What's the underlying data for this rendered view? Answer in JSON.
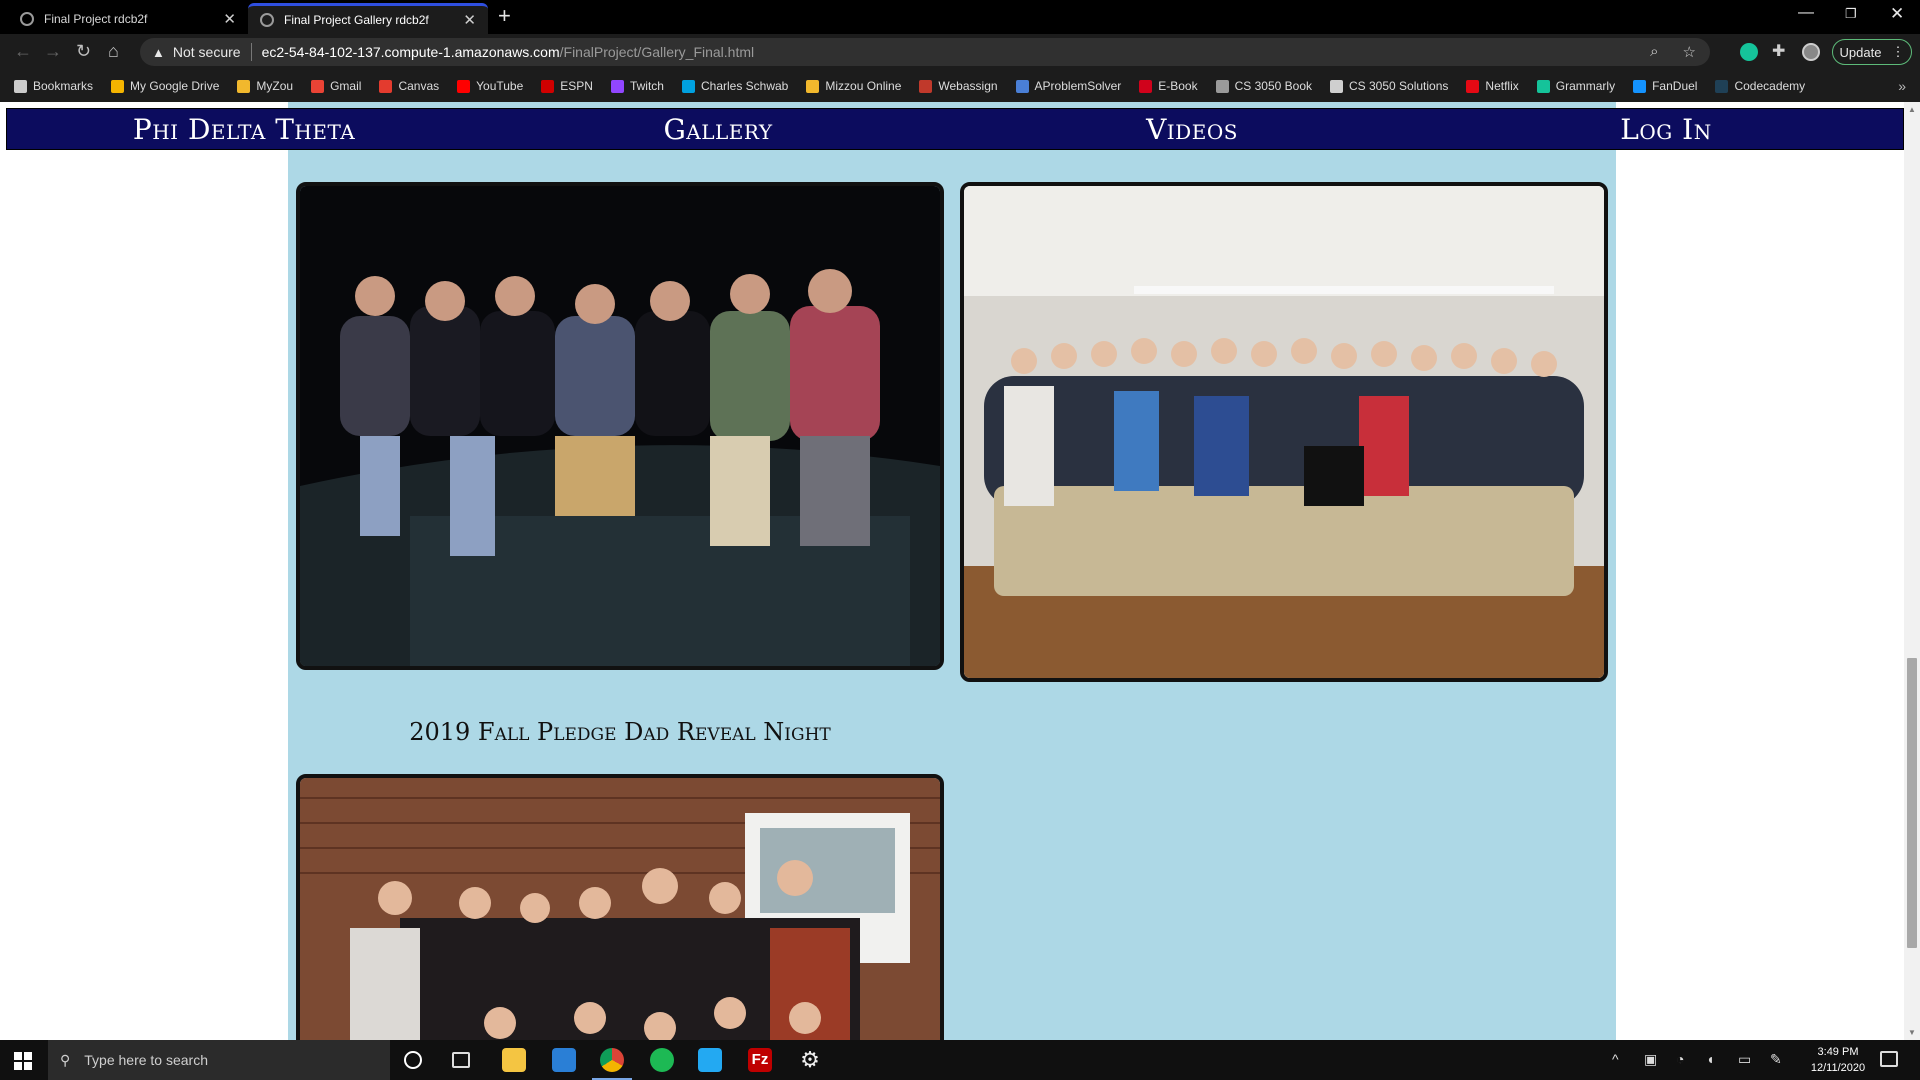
{
  "browser": {
    "tabs": [
      {
        "title": "Final Project rdcb2f",
        "active": false
      },
      {
        "title": "Final Project Gallery rdcb2f",
        "active": true
      }
    ],
    "address": {
      "security_label": "Not secure",
      "host": "ec2-54-84-102-137.compute-1.amazonaws.com",
      "path": "/FinalProject/Gallery_Final.html"
    },
    "update_label": "Update",
    "bookmarks": [
      {
        "label": "Bookmarks",
        "icon": "star-icon",
        "color": "#cccccc"
      },
      {
        "label": "My Google Drive",
        "icon": "google-drive-icon",
        "color": "#f4b400"
      },
      {
        "label": "MyZou",
        "icon": "mizzou-tiger-icon",
        "color": "#f1b82d"
      },
      {
        "label": "Gmail",
        "icon": "gmail-icon",
        "color": "#ea4335"
      },
      {
        "label": "Canvas",
        "icon": "canvas-icon",
        "color": "#e33b2e"
      },
      {
        "label": "YouTube",
        "icon": "youtube-icon",
        "color": "#ff0000"
      },
      {
        "label": "ESPN",
        "icon": "espn-icon",
        "color": "#d00000"
      },
      {
        "label": "Twitch",
        "icon": "twitch-icon",
        "color": "#9146ff"
      },
      {
        "label": "Charles Schwab",
        "icon": "schwab-icon",
        "color": "#00a0df"
      },
      {
        "label": "Mizzou Online",
        "icon": "mizzou-tiger-icon",
        "color": "#f1b82d"
      },
      {
        "label": "Webassign",
        "icon": "webassign-icon",
        "color": "#c0392b"
      },
      {
        "label": "AProblemSolver",
        "icon": "aproblemsolver-icon",
        "color": "#4a7fd6"
      },
      {
        "label": "E-Book",
        "icon": "ebook-icon",
        "color": "#d0021b"
      },
      {
        "label": "CS 3050 Book",
        "icon": "globe-icon",
        "color": "#9a9a9a"
      },
      {
        "label": "CS 3050 Solutions",
        "icon": "wolfram-icon",
        "color": "#cfcfcf"
      },
      {
        "label": "Netflix",
        "icon": "netflix-icon",
        "color": "#e50914"
      },
      {
        "label": "Grammarly",
        "icon": "grammarly-icon",
        "color": "#15c39a"
      },
      {
        "label": "FanDuel",
        "icon": "fanduel-icon",
        "color": "#1493ff"
      },
      {
        "label": "Codecademy",
        "icon": "codecademy-icon",
        "color": "#1f4056"
      }
    ]
  },
  "site": {
    "nav": [
      "Phi Delta Theta",
      "Gallery",
      "Videos",
      "Log In"
    ],
    "captions": [
      "2019 Fall Pledge Dad Reveal Night"
    ],
    "colors": {
      "nav_bg": "#0c0c5e",
      "content_bg": "#add8e6"
    }
  },
  "taskbar": {
    "search_placeholder": "Type here to search",
    "time": "3:49 PM",
    "date": "12/11/2020"
  }
}
